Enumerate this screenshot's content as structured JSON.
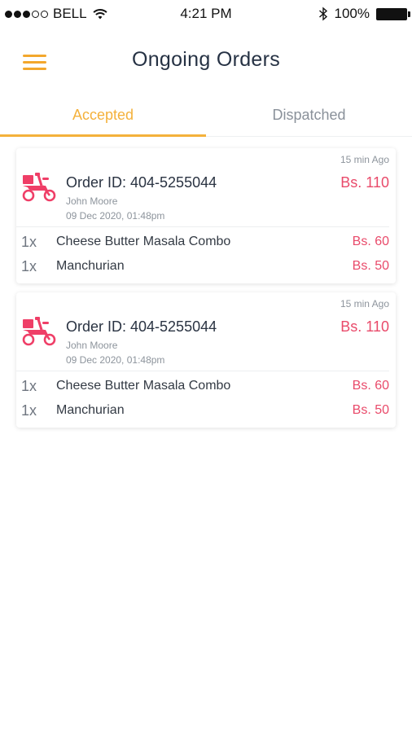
{
  "status_bar": {
    "carrier": "BELL",
    "time": "4:21 PM",
    "battery": "100%"
  },
  "header": {
    "title": "Ongoing Orders"
  },
  "tabs": [
    {
      "label": "Accepted",
      "active": true
    },
    {
      "label": "Dispatched",
      "active": false
    }
  ],
  "colors": {
    "accent": "#f4b13b",
    "price": "#e94a6a",
    "icon": "#ef3e67"
  },
  "orders": [
    {
      "time_ago": "15 min Ago",
      "order_id": "Order ID: 404-5255044",
      "total": "Bs. 110",
      "customer": "John Moore",
      "date": "09 Dec 2020,  01:48pm",
      "items": [
        {
          "qty": "1x",
          "name": "Cheese Butter Masala Combo",
          "price": "Bs. 60"
        },
        {
          "qty": "1x",
          "name": "Manchurian",
          "price": "Bs. 50"
        }
      ]
    },
    {
      "time_ago": "15 min Ago",
      "order_id": "Order ID: 404-5255044",
      "total": "Bs. 110",
      "customer": "John Moore",
      "date": "09 Dec 2020,  01:48pm",
      "items": [
        {
          "qty": "1x",
          "name": "Cheese Butter Masala Combo",
          "price": "Bs. 60"
        },
        {
          "qty": "1x",
          "name": "Manchurian",
          "price": "Bs. 50"
        }
      ]
    }
  ]
}
